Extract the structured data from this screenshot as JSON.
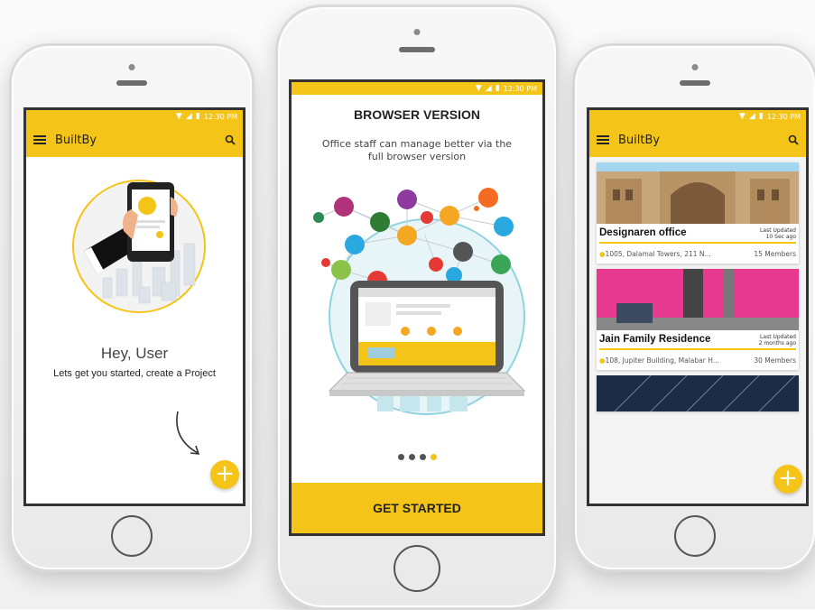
{
  "status": {
    "time": "12:30 PM"
  },
  "left": {
    "app_title": "BuiltBy",
    "greeting": "Hey, User",
    "subtitle": "Lets get you started, create a Project",
    "fab": "+"
  },
  "center": {
    "title": "BROWSER VERSION",
    "description": "Office staff can manage better via the full browser version",
    "page_dots": 4,
    "active_dot": 4,
    "cta": "GET STARTED"
  },
  "right": {
    "app_title": "BuiltBy",
    "fab": "+",
    "projects": [
      {
        "name": "Designaren office",
        "updated_label": "Last Updated",
        "updated_value": "10 Sec ago",
        "address": "1005, Dalamal Towers, 211 N...",
        "members": "15 Members"
      },
      {
        "name": "Jain Family Residence",
        "updated_label": "Last Updated",
        "updated_value": "2 months ago",
        "address": "108, Jupiter Building, Malabar H...",
        "members": "30 Members"
      }
    ]
  },
  "colors": {
    "accent": "#f5c418",
    "dark": "#222222"
  },
  "icons": [
    "menu-icon",
    "search-icon",
    "wifi-icon",
    "signal-icon",
    "battery-icon",
    "add-icon",
    "location-pin-icon"
  ]
}
